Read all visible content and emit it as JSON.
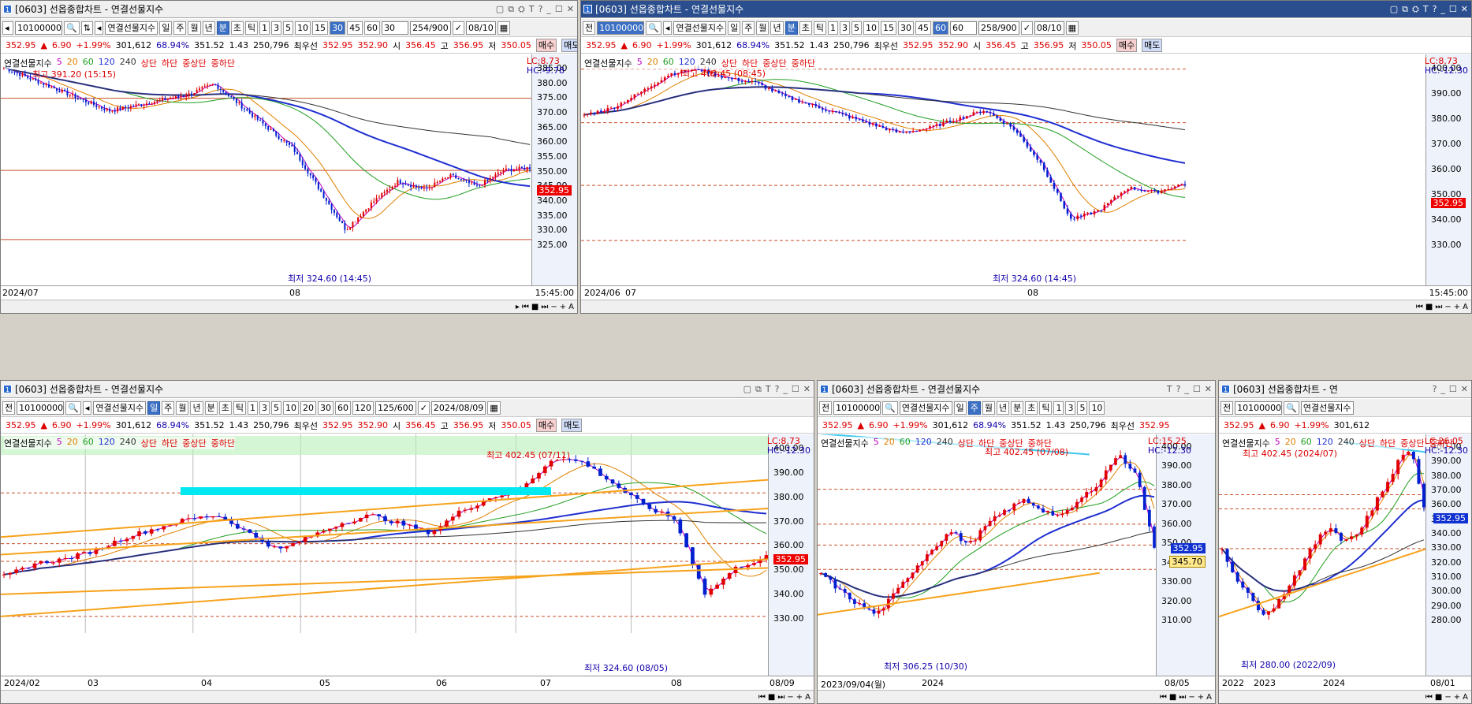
{
  "quote": {
    "price": "352.95",
    "chg": "6.90",
    "pct": "+1.99%",
    "vol": "301,612",
    "ratio": "68.94%",
    "bid1": "351.52",
    "bid2": "1.43",
    "oi": "250,796",
    "best": "최우선",
    "ask": "352.95",
    "ask2": "352.90",
    "open_l": "시",
    "open": "356.45",
    "high_l": "고",
    "high": "356.95",
    "low_l": "저",
    "low": "350.05",
    "buy": "매수",
    "sell": "매도"
  },
  "common": {
    "code": "10100000",
    "name": "연결선물지수",
    "legend": [
      "연결선물지수",
      "5",
      "20",
      "60",
      "120",
      "240",
      "상단",
      "하단",
      "중상단",
      "중하단"
    ],
    "colors": {
      "ma5": "#c000c0",
      "ma20": "#e08000",
      "ma60": "#1f9e1f",
      "ma120": "#1f2fd0",
      "ma240": "#333333",
      "up": "#e00000",
      "down": "#0020d0"
    }
  },
  "w1": {
    "title": "[0603] 선옵종합차트 - 연결선물지수",
    "periods": [
      "일",
      "주",
      "월",
      "년",
      "분",
      "초",
      "틱"
    ],
    "mins": [
      "1",
      "3",
      "5",
      "10",
      "15",
      "30",
      "45",
      "60"
    ],
    "sel": "30",
    "count": "254",
    "max": "900",
    "date": "08/10",
    "lc": "LC:8.73",
    "hc": "HC:-9.78",
    "hi": "최고 391.20 (15:15)",
    "lo": "최저 324.60 (14:45)",
    "price_tag": "352.95",
    "yt": [
      "385.00",
      "380.00",
      "375.00",
      "370.00",
      "365.00",
      "360.00",
      "355.00",
      "350.00",
      "345.00",
      "340.00",
      "335.00",
      "330.00",
      "325.00"
    ],
    "x0": "2024/07",
    "x1": "08",
    "xt": "15:45:00"
  },
  "w2": {
    "title": "[0603] 선옵종합차트 - 연결선물지수",
    "mins": [
      "1",
      "3",
      "5",
      "10",
      "15",
      "30",
      "45",
      "60"
    ],
    "sel": "60",
    "count": "258",
    "max": "900",
    "date": "08/10",
    "lc": "LC:8.73",
    "hc": "HC:-12.30",
    "hi": "최고 402.45 (08:45)",
    "lo": "최저 324.60 (14:45)",
    "price_tag": "352.95",
    "yt": [
      "400.00",
      "390.00",
      "380.00",
      "370.00",
      "360.00",
      "350.00",
      "340.00",
      "330.00"
    ],
    "x0": "2024/06",
    "x1": "07",
    "x2": "08",
    "xt": "15:45:00",
    "label_jeon": "전"
  },
  "w3": {
    "title": "[0603] 선옵종합차트 - 연결선물지수",
    "mins": [
      "1",
      "3",
      "5",
      "10",
      "20",
      "30",
      "60",
      "120"
    ],
    "count": "125",
    "max": "600",
    "date": "2024/08/09",
    "lc": "LC:8.73",
    "hc": "HC:-12.30",
    "hi": "최고 402.45 (07/11)",
    "lo": "최저 324.60 (08/05)",
    "price_tag": "352.95",
    "yt": [
      "400.00",
      "390.00",
      "380.00",
      "370.00",
      "360.00",
      "350.00",
      "340.00",
      "330.00"
    ],
    "xl": [
      "2024/02",
      "03",
      "04",
      "05",
      "06",
      "07",
      "08",
      "08/09"
    ]
  },
  "w4": {
    "title": "[0603] 선옵종합차트 - 연결선물지수",
    "mins": [
      "1",
      "3",
      "5",
      "10"
    ],
    "lc": "LC:15.25",
    "hc": "HC:-12.30",
    "hi": "최고 402.45 (07/08)",
    "lo": "최저 306.25 (10/30)",
    "price_tag": "352.95",
    "tag2": "345.70",
    "yt": [
      "400.00",
      "390.00",
      "380.00",
      "370.00",
      "360.00",
      "350.00",
      "340.00",
      "330.00",
      "320.00",
      "310.00"
    ],
    "xl": [
      "2023/09/04(월)",
      "2024",
      "08/05"
    ]
  },
  "w5": {
    "title": "[0603] 선옵종합차트 - 연",
    "lc": "LC:26.05",
    "hc": "HC:-12.30",
    "hi": "최고 402.45 (2024/07)",
    "lo": "최저 280.00 (2022/09)",
    "price_tag": "352.95",
    "yt": [
      "400.00",
      "390.00",
      "380.00",
      "370.00",
      "360.00",
      "350.00",
      "340.00",
      "330.00",
      "320.00",
      "310.00",
      "300.00",
      "290.00",
      "280.00"
    ],
    "xl": [
      "2022",
      "2023",
      "2024",
      "08/01"
    ]
  }
}
